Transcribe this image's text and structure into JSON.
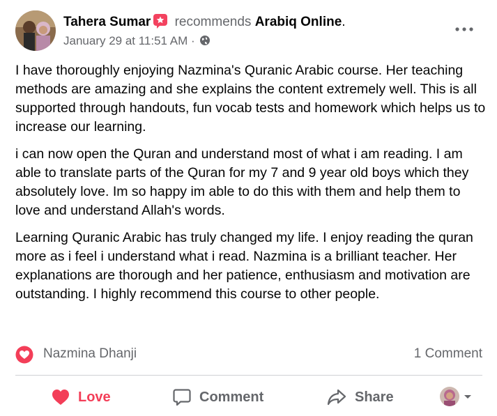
{
  "post": {
    "author": "Tahera Sumar",
    "recommends_text": "recommends",
    "page_name": "Arabiq Online",
    "period": ".",
    "timestamp": "January 29 at 11:51 AM",
    "separator": "·",
    "privacy_icon": "globe-icon",
    "paragraphs": [
      "I have thoroughly enjoying Nazmina's Quranic Arabic course. Her teaching methods are amazing and she explains the content extremely well. This is all supported through handouts, fun vocab tests and homework which helps us to increase our learning.",
      "i can now open the Quran and understand most of what i am reading. I am able to translate parts of the Quran for my 7 and 9 year old boys which they absolutely love. Im so happy im able to do this with them and help them to love and understand Allah's words.",
      "Learning Quranic Arabic has truly changed my life. I enjoy reading the quran more as i feel i understand what i read. Nazmina is a brilliant teacher. Her explanations are thorough and her patience, enthusiasm and motivation are outstanding. I highly recommend this course to other people."
    ]
  },
  "reactions": {
    "reaction_icon": "love-reaction-icon",
    "reactor": "Nazmina Dhanji",
    "comment_count": "1 Comment"
  },
  "actions": {
    "love": "Love",
    "comment": "Comment",
    "share": "Share"
  },
  "colors": {
    "love": "#f33e58",
    "secondary_text": "#65676b",
    "recommend_badge": "#f3425f",
    "divider": "#ced0d4"
  }
}
